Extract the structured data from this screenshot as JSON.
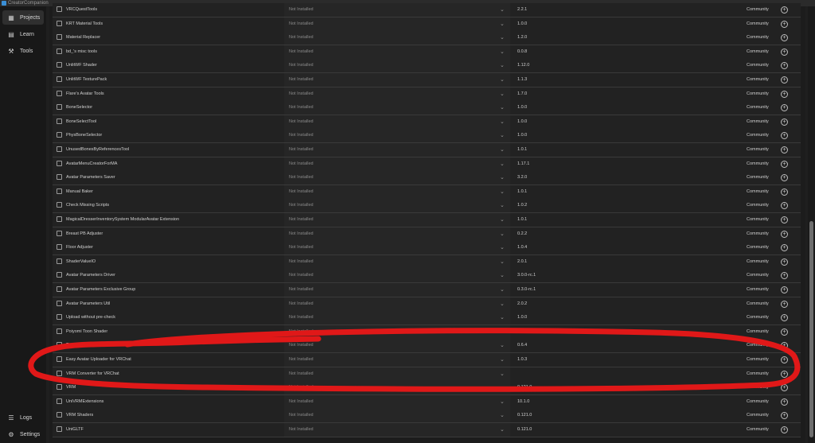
{
  "window": {
    "title": "CreatorCompanion"
  },
  "sidebar": {
    "items": [
      {
        "label": "Projects",
        "icon": "grid-icon",
        "active": true
      },
      {
        "label": "Learn",
        "icon": "book-icon",
        "active": false
      },
      {
        "label": "Tools",
        "icon": "tools-icon",
        "active": false
      }
    ],
    "bottom_items": [
      {
        "label": "Logs",
        "icon": "logs-icon"
      },
      {
        "label": "Settings",
        "icon": "gear-icon"
      }
    ]
  },
  "packages": [
    {
      "name": "VRCQuestTools",
      "status": "Not Installed",
      "version": "2.2.1",
      "repo": "Community"
    },
    {
      "name": "KRT Material Tools",
      "status": "Not Installed",
      "version": "1.0.0",
      "repo": "Community"
    },
    {
      "name": "Material Replacer",
      "status": "Not Installed",
      "version": "1.2.0",
      "repo": "Community"
    },
    {
      "name": "bd_'s misc tools",
      "status": "Not Installed",
      "version": "0.0.8",
      "repo": "Community"
    },
    {
      "name": "UnlitWF Shader",
      "status": "Not Installed",
      "version": "1.12.0",
      "repo": "Community"
    },
    {
      "name": "UnlitWF TexturePack",
      "status": "Not Installed",
      "version": "1.1.3",
      "repo": "Community"
    },
    {
      "name": "Flare's Avatar Tools",
      "status": "Not Installed",
      "version": "1.7.0",
      "repo": "Community"
    },
    {
      "name": "BoneSelector",
      "status": "Not Installed",
      "version": "1.0.0",
      "repo": "Community"
    },
    {
      "name": "BoneSelectTool",
      "status": "Not Installed",
      "version": "1.0.0",
      "repo": "Community"
    },
    {
      "name": "PhysBoneSelector",
      "status": "Not Installed",
      "version": "1.0.0",
      "repo": "Community"
    },
    {
      "name": "UnusedBonesByReferencesTool",
      "status": "Not Installed",
      "version": "1.0.1",
      "repo": "Community"
    },
    {
      "name": "AvatarMenuCreatorForMA",
      "status": "Not Installed",
      "version": "1.17.1",
      "repo": "Community"
    },
    {
      "name": "Avatar Parameters Saver",
      "status": "Not Installed",
      "version": "3.2.0",
      "repo": "Community"
    },
    {
      "name": "Manual Baker",
      "status": "Not Installed",
      "version": "1.0.1",
      "repo": "Community"
    },
    {
      "name": "Check Missing Scripts",
      "status": "Not Installed",
      "version": "1.0.2",
      "repo": "Community"
    },
    {
      "name": "MagicalDresserInventorySystem ModularAvatar Extension",
      "status": "Not Installed",
      "version": "1.0.1",
      "repo": "Community"
    },
    {
      "name": "Breast PB Adjuster",
      "status": "Not Installed",
      "version": "0.2.2",
      "repo": "Community"
    },
    {
      "name": "Floor Adjuster",
      "status": "Not Installed",
      "version": "1.0.4",
      "repo": "Community"
    },
    {
      "name": "ShaderValueIO",
      "status": "Not Installed",
      "version": "2.0.1",
      "repo": "Community"
    },
    {
      "name": "Avatar Parameters Driver",
      "status": "Not Installed",
      "version": "3.0.0-rc.1",
      "repo": "Community"
    },
    {
      "name": "Avatar Parameters Exclusive Group",
      "status": "Not Installed",
      "version": "0.3.0-rc.1",
      "repo": "Community"
    },
    {
      "name": "Avatar Parameters Util",
      "status": "Not Installed",
      "version": "2.0.2",
      "repo": "Community"
    },
    {
      "name": "Upload without pre-check",
      "status": "Not Installed",
      "version": "1.0.0",
      "repo": "Community"
    },
    {
      "name": "Poiyomi Toon Shader",
      "status": "Not Installed",
      "version": "",
      "repo": "Community"
    },
    {
      "name": "TexTransTool",
      "status": "Not Installed",
      "version": "0.6.4",
      "repo": "Community"
    },
    {
      "name": "Easy Avatar Uploader for VRChat",
      "status": "Not Installed",
      "version": "1.0.3",
      "repo": "Community"
    },
    {
      "name": "VRM Converter for VRChat",
      "status": "Not Installed",
      "version": "",
      "repo": "Community"
    },
    {
      "name": "VRM",
      "status": "Not Installed",
      "version": "0.121.0",
      "repo": "Community"
    },
    {
      "name": "UniVRMExtensions",
      "status": "Not Installed",
      "version": "10.1.0",
      "repo": "Community"
    },
    {
      "name": "VRM Shaders",
      "status": "Not Installed",
      "version": "0.121.0",
      "repo": "Community"
    },
    {
      "name": "UniGLTF",
      "status": "Not Installed",
      "version": "0.121.0",
      "repo": "Community"
    }
  ],
  "icons": {
    "package": "package-icon",
    "add": "plus-circle-icon",
    "dropdown": "chevron-down-icon"
  },
  "annotation": {
    "color": "#e01818"
  }
}
